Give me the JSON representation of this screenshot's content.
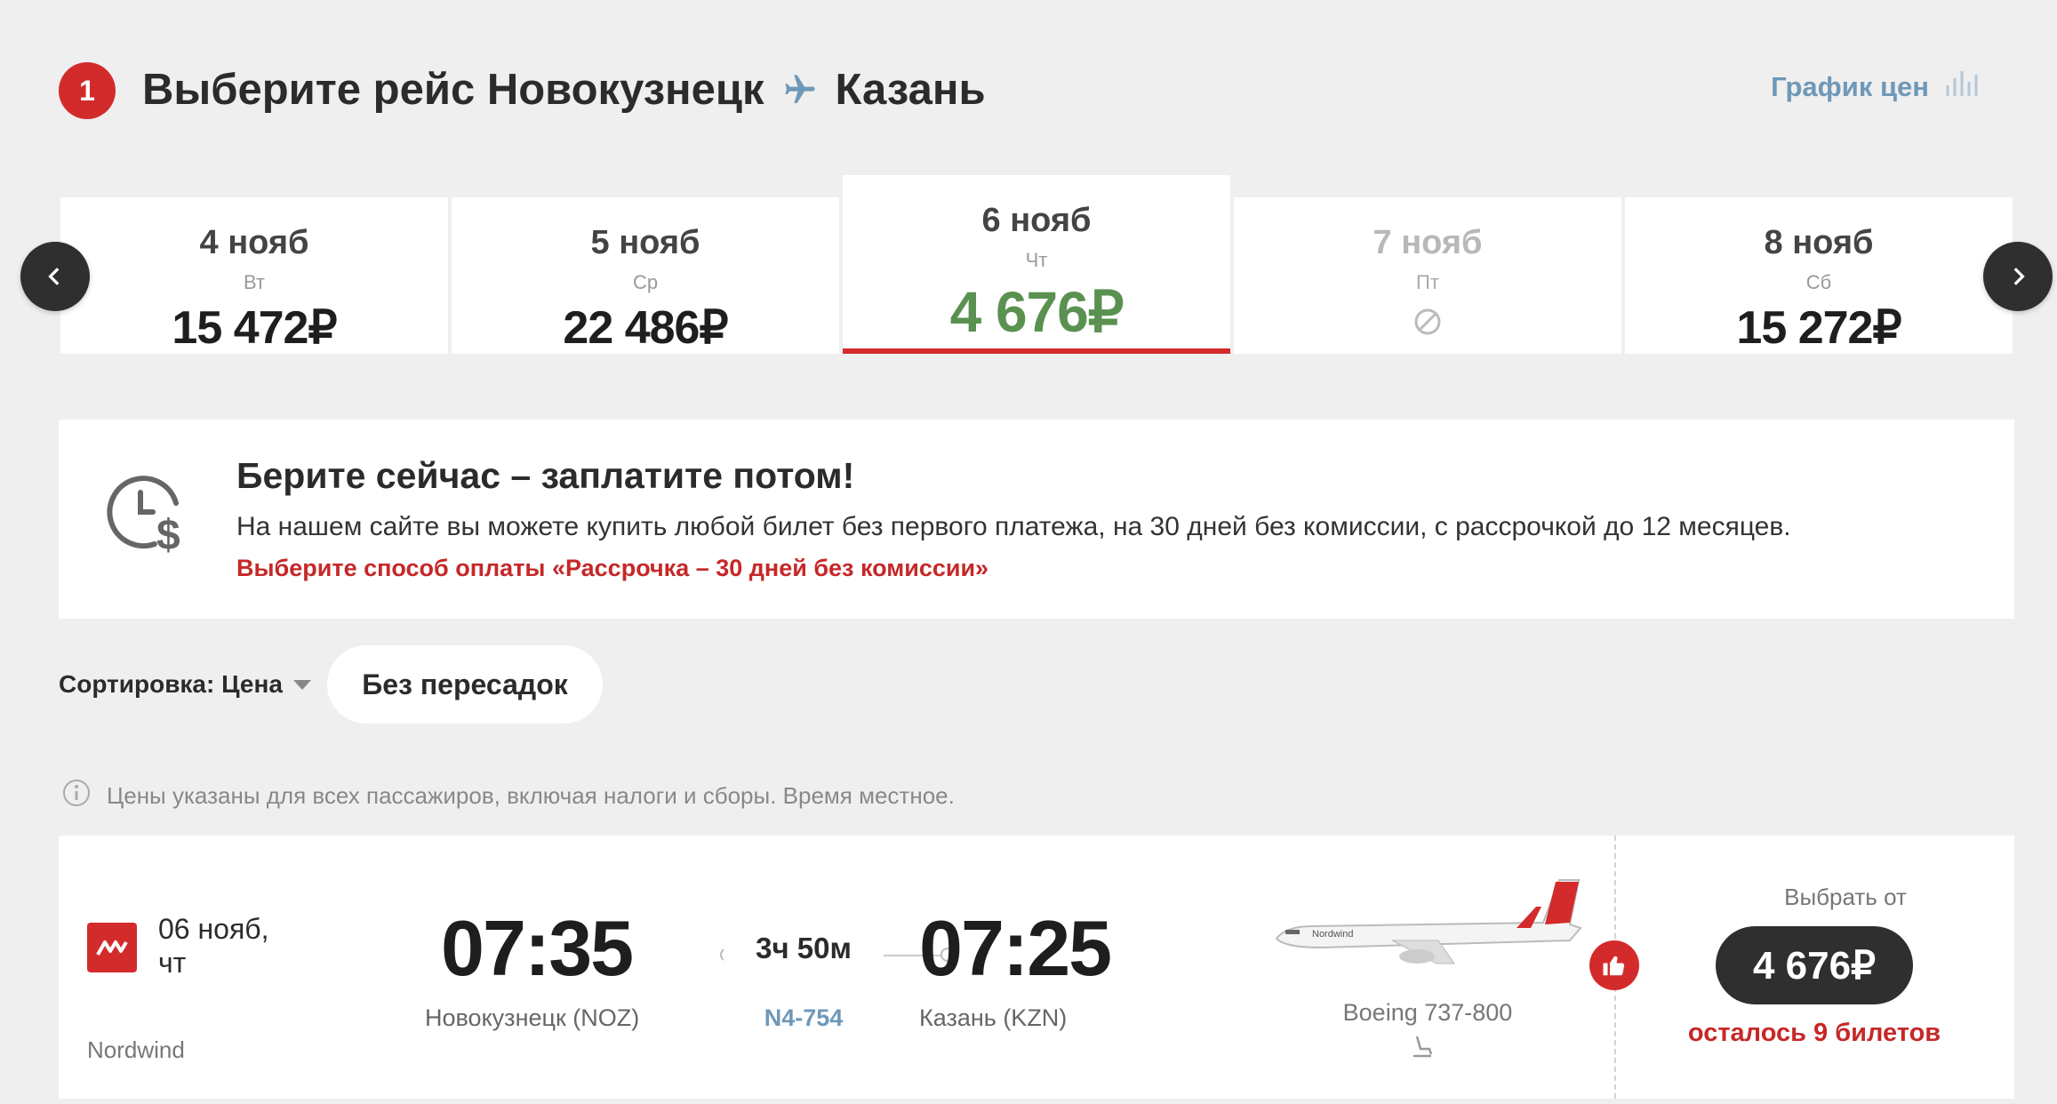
{
  "header": {
    "step": "1",
    "title_prefix": "Выберите рейс Новокузнецк",
    "title_destination": "Казань",
    "price_chart_label": "График цен"
  },
  "date_carousel": {
    "days": [
      {
        "date": "4 нояб",
        "weekday": "Вт",
        "price": "15 472₽",
        "state": "normal"
      },
      {
        "date": "5 нояб",
        "weekday": "Ср",
        "price": "22 486₽",
        "state": "normal"
      },
      {
        "date": "6 нояб",
        "weekday": "Чт",
        "price": "4 676₽",
        "state": "selected"
      },
      {
        "date": "7 нояб",
        "weekday": "Пт",
        "price": "",
        "state": "unavailable"
      },
      {
        "date": "8 нояб",
        "weekday": "Сб",
        "price": "15 272₽",
        "state": "normal"
      }
    ]
  },
  "promo": {
    "title": "Берите сейчас – заплатите потом!",
    "text": "На нашем сайте вы можете купить любой билет без первого платежа, на 30 дней без комиссии, с рассрочкой до 12 месяцев.",
    "link": "Выберите способ оплаты «Рассрочка – 30 дней без комиссии»"
  },
  "filters": {
    "sort_label": "Сортировка: Цена",
    "chip_label": "Без пересадок"
  },
  "info_note": "Цены указаны для всех пассажиров, включая налоги и сборы. Время местное.",
  "flight": {
    "date_line1": "06 нояб,",
    "date_line2": "чт",
    "airline": "Nordwind",
    "departure_time": "07:35",
    "departure_city": "Новокузнецк (NOZ)",
    "duration": "3ч 50м",
    "flight_number": "N4-754",
    "arrival_time": "07:25",
    "arrival_city": "Казань (KZN)",
    "aircraft": "Boeing 737-800",
    "choose_from": "Выбрать от",
    "price": "4 676₽",
    "seats_left": "осталось 9 билетов"
  },
  "colors": {
    "accent_red": "#d32b2b",
    "selected_price_green": "#5b9150",
    "link_blue": "#6f98b8",
    "dark_button": "#2f2f2f"
  }
}
